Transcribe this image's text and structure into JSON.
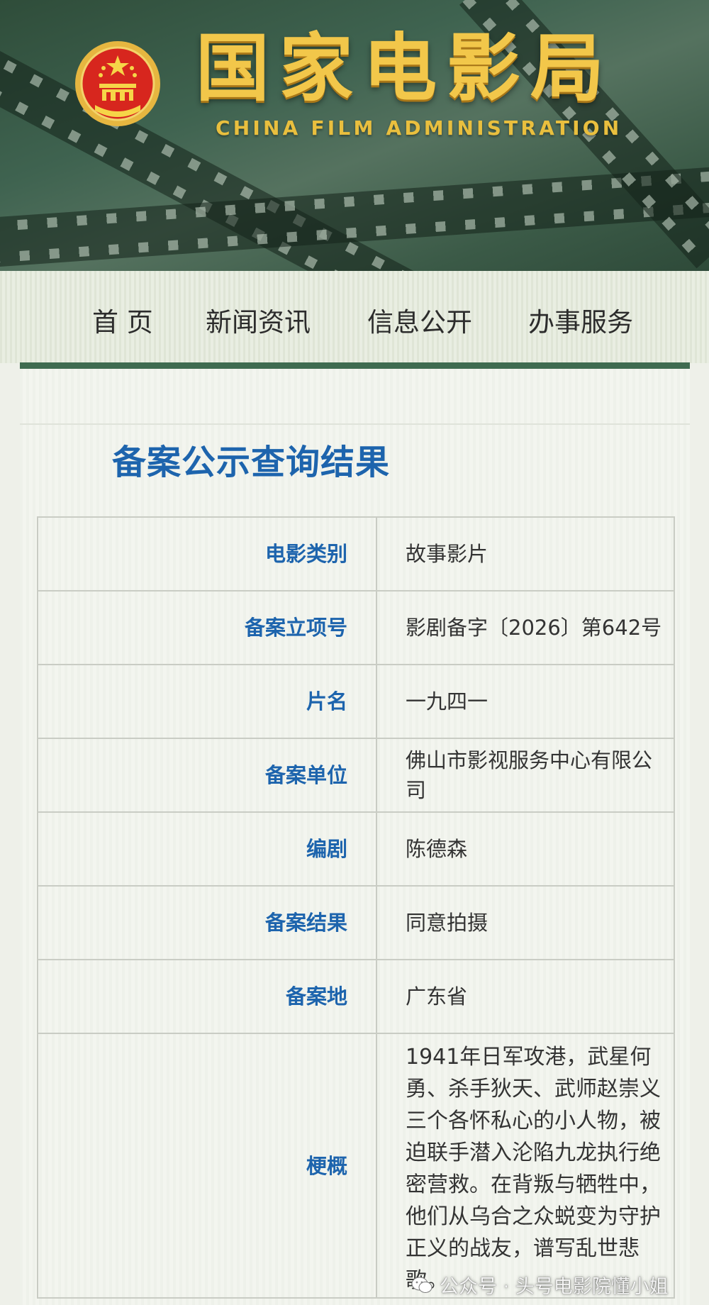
{
  "header": {
    "title": "国家电影局",
    "subtitle": "CHINA FILM ADMINISTRATION",
    "emblem_icon": "national-emblem-icon",
    "colors": {
      "gold": "#f2c74a",
      "banner_green": "#3f6350"
    }
  },
  "nav": {
    "items": [
      {
        "label": "首 页"
      },
      {
        "label": "新闻资讯"
      },
      {
        "label": "信息公开"
      },
      {
        "label": "办事服务"
      }
    ]
  },
  "page": {
    "heading": "备案公示查询结果",
    "accent_color": "#1d64ad"
  },
  "record": {
    "rows": [
      {
        "label": "电影类别",
        "value": "故事影片"
      },
      {
        "label": "备案立项号",
        "value": "影剧备字〔2026〕第642号"
      },
      {
        "label": "片名",
        "value": "一九四一"
      },
      {
        "label": "备案单位",
        "value": "佛山市影视服务中心有限公司"
      },
      {
        "label": "编剧",
        "value": "陈德森"
      },
      {
        "label": "备案结果",
        "value": "同意拍摄"
      },
      {
        "label": "备案地",
        "value": "广东省"
      },
      {
        "label": "梗概",
        "value": "1941年日军攻港，武星何勇、杀手狄天、武师赵崇义三个各怀私心的小人物，被迫联手潜入沦陷九龙执行绝密营救。在背叛与牺牲中，他们从乌合之众蜕变为守护正义的战友，谱写乱世悲歌。"
      }
    ]
  },
  "watermark": {
    "text": "公众号 · 头号电影院懂小姐",
    "icon": "wechat-official-account-icon"
  }
}
